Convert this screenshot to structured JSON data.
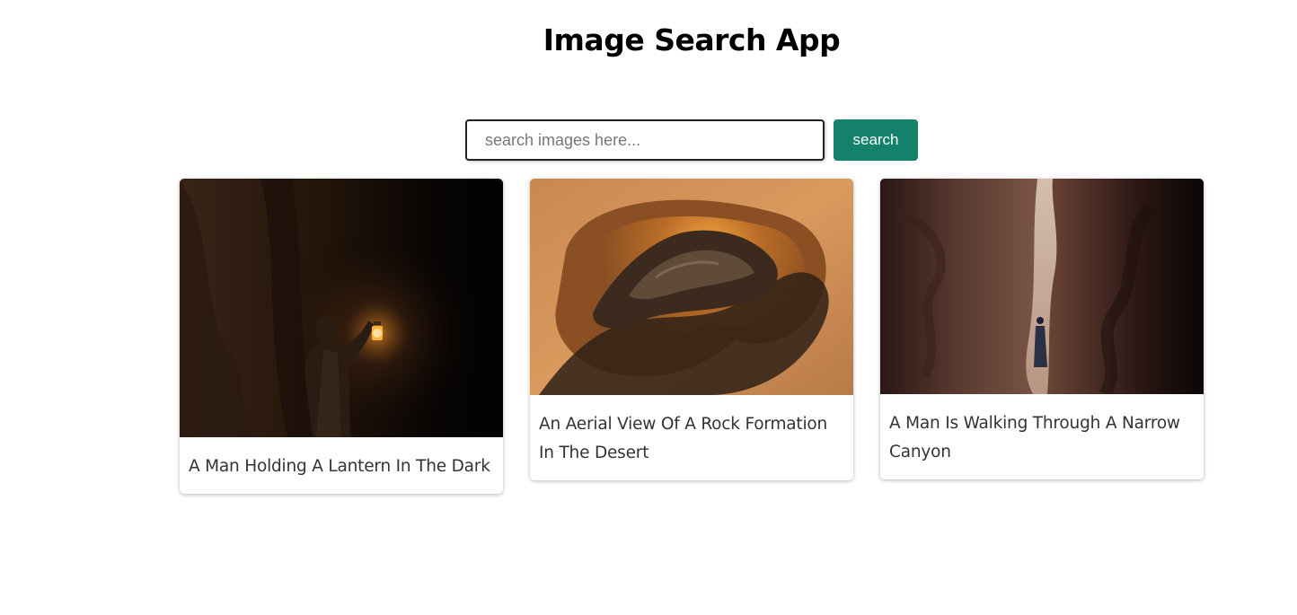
{
  "header": {
    "title": "Image Search App"
  },
  "search": {
    "placeholder": "search images here...",
    "value": "",
    "button_label": "search"
  },
  "results": [
    {
      "title": "A Man Holding A Lantern In The Dark",
      "image": "man-with-lantern-photo"
    },
    {
      "title": "An Aerial View Of A Rock Formation In The Desert",
      "image": "desert-rock-aerial-photo"
    },
    {
      "title": "A Man Is Walking Through A Narrow Canyon",
      "image": "narrow-canyon-photo"
    }
  ]
}
